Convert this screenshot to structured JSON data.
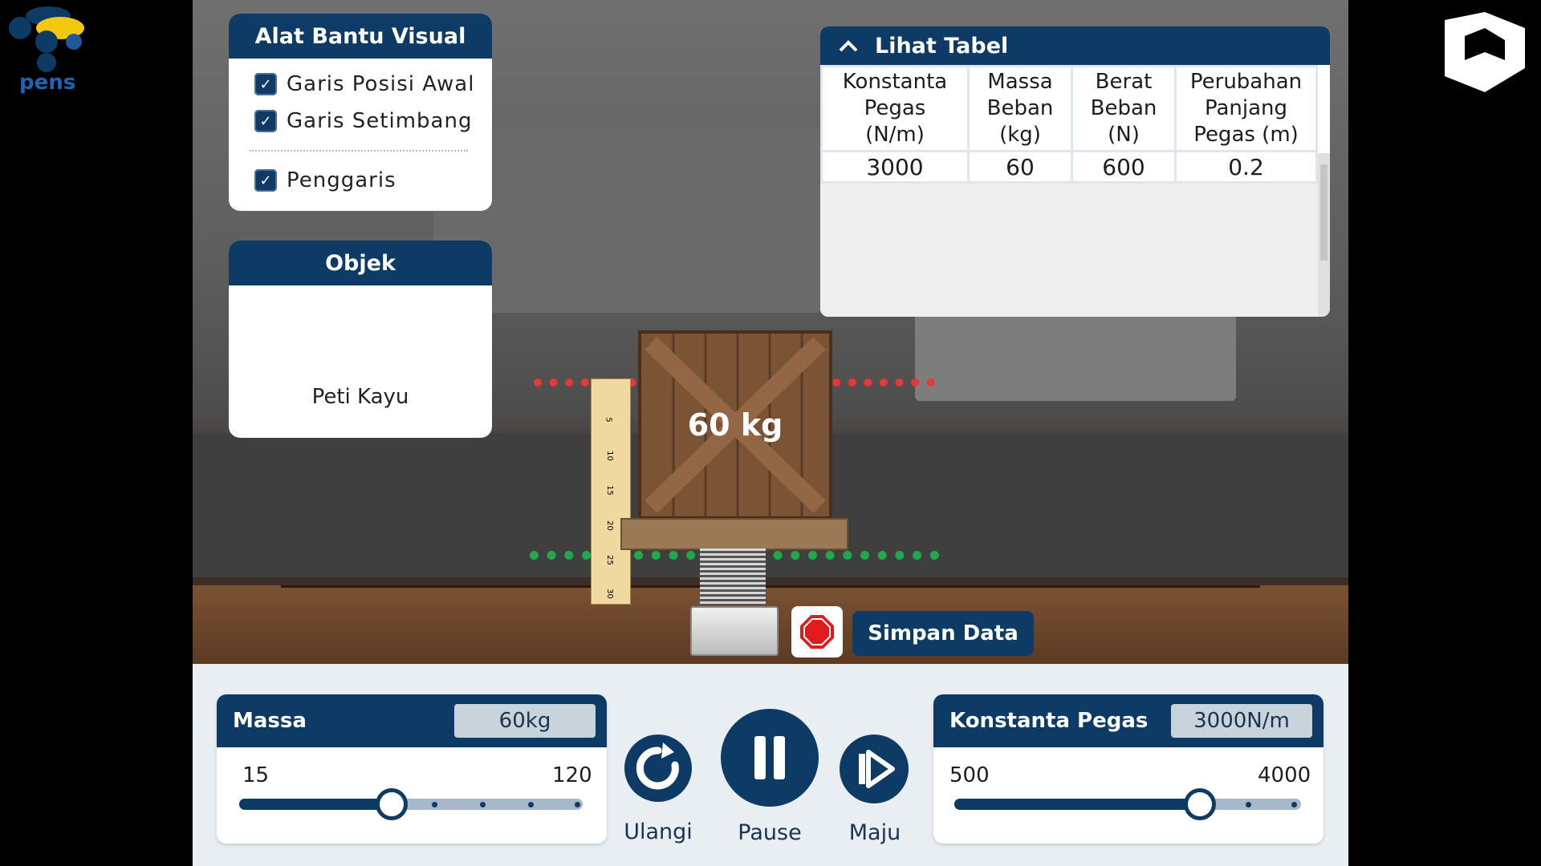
{
  "logos": {
    "left_text": "pens",
    "right_name": "publisher-logo"
  },
  "visual_aids": {
    "title": "Alat Bantu Visual",
    "items": [
      {
        "label": "Garis Posisi Awal",
        "checked": true
      },
      {
        "label": "Garis Setimbang",
        "checked": true
      },
      {
        "label": "Penggaris",
        "checked": true
      }
    ]
  },
  "object_panel": {
    "title": "Objek",
    "object_name": "Peti Kayu"
  },
  "data_table": {
    "toggle_label": "Lihat Tabel",
    "headers": [
      [
        "Konstanta",
        "Pegas",
        "(N/m)"
      ],
      [
        "Massa",
        "Beban",
        "(kg)"
      ],
      [
        "Berat",
        "Beban",
        "(N)"
      ],
      [
        "Perubahan",
        "Panjang",
        "Pegas (m)"
      ]
    ],
    "rows": [
      [
        "3000",
        "60",
        "600",
        "0.2"
      ]
    ]
  },
  "crate": {
    "label": "60 kg"
  },
  "ruler": {
    "ticks": [
      "5",
      "10",
      "15",
      "20",
      "25",
      "30"
    ]
  },
  "actions": {
    "save_label": "Simpan Data"
  },
  "mass_control": {
    "title": "Massa",
    "value": "60kg",
    "min": "15",
    "max": "120",
    "level": 0.43
  },
  "spring_control": {
    "title": "Konstanta Pegas",
    "value": "3000N/m",
    "min": "500",
    "max": "4000",
    "level": 0.71
  },
  "playback": {
    "reset_label": "Ulangi",
    "pause_label": "Pause",
    "forward_label": "Maju"
  },
  "colors": {
    "primary": "#0d3b66",
    "guide_red": "#e53935",
    "guide_green": "#1faa4a",
    "stop_red": "#e11b1b"
  }
}
